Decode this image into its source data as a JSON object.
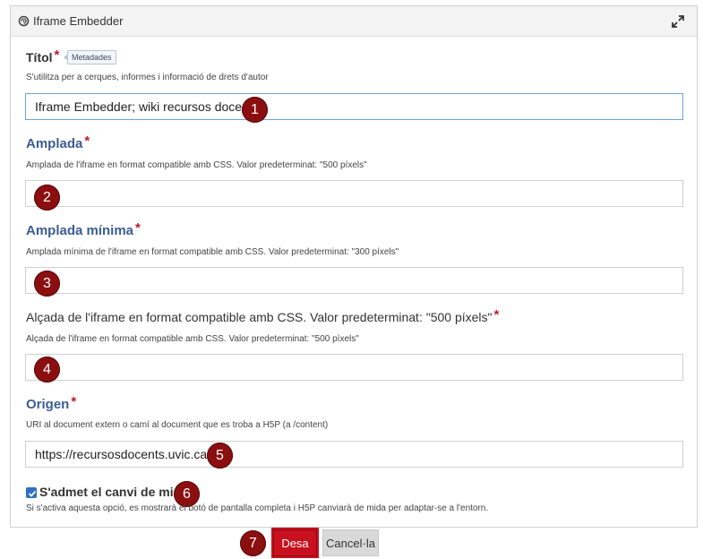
{
  "header": {
    "title": "Iframe Embedder"
  },
  "fields": {
    "title": {
      "label": "Títol",
      "required": "*",
      "badge": "Metadades",
      "description": "S'utilitza per a cerques, informes i informació de drets d'autor",
      "value": "Iframe Embedder; wiki recursos docents"
    },
    "width": {
      "label": "Amplada",
      "required": "*",
      "description": "Amplada de l'iframe en format compatible amb CSS. Valor predeterminat: \"500 píxels\"",
      "value": ""
    },
    "min_width": {
      "label": "Amplada mínima",
      "required": "*",
      "description": "Amplada mínima de l'iframe en format compatible amb CSS. Valor predeterminat: \"300 píxels\"",
      "value": ""
    },
    "height": {
      "label": "Alçada de l'iframe en format compatible amb CSS. Valor predeterminat: \"500 píxels\"",
      "required": "*",
      "description": "Alçada de l'iframe en format compatible amb CSS. Valor predeterminat: \"500 píxels\"",
      "value": ""
    },
    "source": {
      "label": "Origen",
      "required": "*",
      "description": "URI al document extern o camí al document que es troba a H5P (a /content)",
      "value": "https://recursosdocents.uvic.cat/"
    },
    "resize": {
      "label": "S'admet el canvi de mida",
      "checked": true,
      "description": "Si s'activa aquesta opció, es mostrarà el botó de pantalla completa i H5P canviarà de mida per adaptar-se a l'entorn."
    }
  },
  "markers": [
    "1",
    "2",
    "3",
    "4",
    "5",
    "6",
    "7"
  ],
  "buttons": {
    "save": "Desa",
    "cancel": "Cancel·la"
  },
  "colors": {
    "accent": "#c8101e",
    "label_blue": "#3c5c96",
    "marker": "#8b0f10"
  }
}
